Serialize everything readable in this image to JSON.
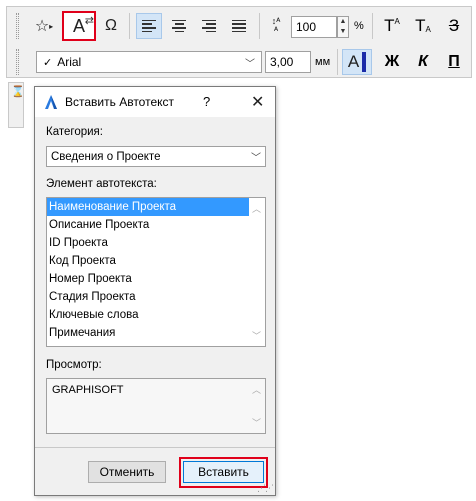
{
  "toolbar": {
    "zoom_value": "100",
    "percent_label": "%",
    "font_name": "Arial",
    "font_checkmark": "✓",
    "size_value": "3,00",
    "unit_label": "мм",
    "bold_label": "Ж",
    "italic_label": "К",
    "underline_label": "П",
    "superscript_label": "T",
    "subscript_label": "T",
    "strike_label": "З",
    "autotext_glyph": "A",
    "omega_glyph": "Ω",
    "star_glyph": "☆",
    "a_letter": "A"
  },
  "dialog": {
    "title": "Вставить Автотекст",
    "help_glyph": "?",
    "close_glyph": "✕",
    "category_label": "Категория:",
    "category_value": "Сведения о Проекте",
    "element_label": "Элемент автотекста:",
    "items": [
      "Наименование Проекта",
      "Описание Проекта",
      "ID Проекта",
      "Код Проекта",
      "Номер Проекта",
      "Стадия Проекта",
      "Ключевые слова",
      "Примечания"
    ],
    "selected_index": 0,
    "preview_label": "Просмотр:",
    "preview_text": "GRAPHISOFT",
    "cancel_label": "Отменить",
    "insert_label": "Вставить"
  },
  "colors": {
    "selection": "#3399ff",
    "highlight_frame": "#e0001a",
    "primary_border": "#0078d7"
  }
}
